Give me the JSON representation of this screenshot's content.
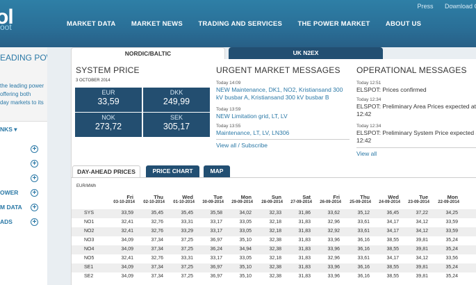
{
  "header": {
    "logo_top": "ol",
    "logo_bottom": "oot",
    "top_links": [
      "Press",
      "Download C"
    ],
    "nav": [
      "MARKET DATA",
      "MARKET NEWS",
      "TRADING AND SERVICES",
      "THE POWER MARKET",
      "ABOUT US"
    ]
  },
  "sidebar": {
    "title": "EADING POWER",
    "desc": [
      "the leading power",
      "offering both",
      "day markets to its"
    ],
    "items": [
      "NKS ▾",
      "",
      "",
      "",
      "OWER",
      "M DATA",
      "ADS"
    ]
  },
  "tabs": {
    "nordic": "NORDIC/BALTIC",
    "uk": "UK N2EX"
  },
  "system_price": {
    "title": "SYSTEM PRICE",
    "date": "3 OCTOBER 2014",
    "prices": [
      {
        "currency": "EUR",
        "value": "33,59"
      },
      {
        "currency": "DKK",
        "value": "249,99"
      },
      {
        "currency": "NOK",
        "value": "273,72"
      },
      {
        "currency": "SEK",
        "value": "305,17"
      }
    ]
  },
  "urgent": {
    "title": "URGENT MARKET MESSAGES",
    "messages": [
      {
        "time": "Today 14:09",
        "text": "NEW Maintenance, DK1, NO2, Kristiansand 300 kV busbar A, Kristiansand 300 kV busbar B"
      },
      {
        "time": "Today 13:59",
        "text": "NEW Limitation grid, LT, LV"
      },
      {
        "time": "Today 13:55",
        "text": "Maintenance, LT, LV, LN306"
      }
    ],
    "link": "View all / Subscribe"
  },
  "operational": {
    "title": "OPERATIONAL MESSAGES",
    "messages": [
      {
        "time": "Today 12:51",
        "text": "ELSPOT: Prices confirmed"
      },
      {
        "time": "Today 12:34",
        "text": "ELSPOT: Preliminary Area Prices expected at 12:42"
      },
      {
        "time": "Today 12:34",
        "text": "ELSPOT: Preliminary System Price expected at 12:42"
      }
    ],
    "link": "View all"
  },
  "subtabs": [
    "DAY-AHEAD PRICES",
    "PRICE CHART",
    "MAP"
  ],
  "table": {
    "unit": "EUR/MWh",
    "days": [
      "Fri",
      "Thu",
      "Wed",
      "Tue",
      "Mon",
      "Sun",
      "Sat",
      "Fri",
      "Thu",
      "Wed",
      "Tue",
      "Mon"
    ],
    "dates": [
      "03-10-2014",
      "02-10-2014",
      "01-10-2014",
      "30-09-2014",
      "29-09-2014",
      "28-09-2014",
      "27-09-2014",
      "26-09-2014",
      "25-09-2014",
      "24-09-2014",
      "23-09-2014",
      "22-09-2014"
    ],
    "rows": [
      {
        "label": "SYS",
        "values": [
          "33,59",
          "35,45",
          "35,45",
          "35,58",
          "34,02",
          "32,33",
          "31,86",
          "33,62",
          "35,12",
          "36,45",
          "37,22",
          "34,25"
        ]
      },
      {
        "label": "NO1",
        "values": [
          "32,41",
          "32,76",
          "33,31",
          "33,17",
          "33,05",
          "32,18",
          "31,83",
          "32,96",
          "33,61",
          "34,17",
          "34,12",
          "33,59"
        ]
      },
      {
        "label": "NO2",
        "values": [
          "32,41",
          "32,76",
          "33,29",
          "33,17",
          "33,05",
          "32,18",
          "31,83",
          "32,92",
          "33,61",
          "34,17",
          "34,12",
          "33,59"
        ]
      },
      {
        "label": "NO3",
        "values": [
          "34,09",
          "37,34",
          "37,25",
          "36,97",
          "35,10",
          "32,38",
          "31,83",
          "33,96",
          "36,16",
          "38,55",
          "39,81",
          "35,24"
        ]
      },
      {
        "label": "NO4",
        "values": [
          "34,09",
          "37,34",
          "37,25",
          "36,24",
          "34,94",
          "32,38",
          "31,83",
          "33,96",
          "36,16",
          "38,55",
          "39,81",
          "35,24"
        ]
      },
      {
        "label": "NO5",
        "values": [
          "32,41",
          "32,76",
          "33,31",
          "33,17",
          "33,05",
          "32,18",
          "31,83",
          "32,96",
          "33,61",
          "34,17",
          "34,12",
          "33,56"
        ]
      },
      {
        "label": "SE1",
        "values": [
          "34,09",
          "37,34",
          "37,25",
          "36,97",
          "35,10",
          "32,38",
          "31,83",
          "33,96",
          "36,16",
          "38,55",
          "39,81",
          "35,24"
        ]
      },
      {
        "label": "SE2",
        "values": [
          "34,09",
          "37,34",
          "37,25",
          "36,97",
          "35,10",
          "32,38",
          "31,83",
          "33,96",
          "36,16",
          "38,55",
          "39,81",
          "35,24"
        ]
      }
    ]
  }
}
